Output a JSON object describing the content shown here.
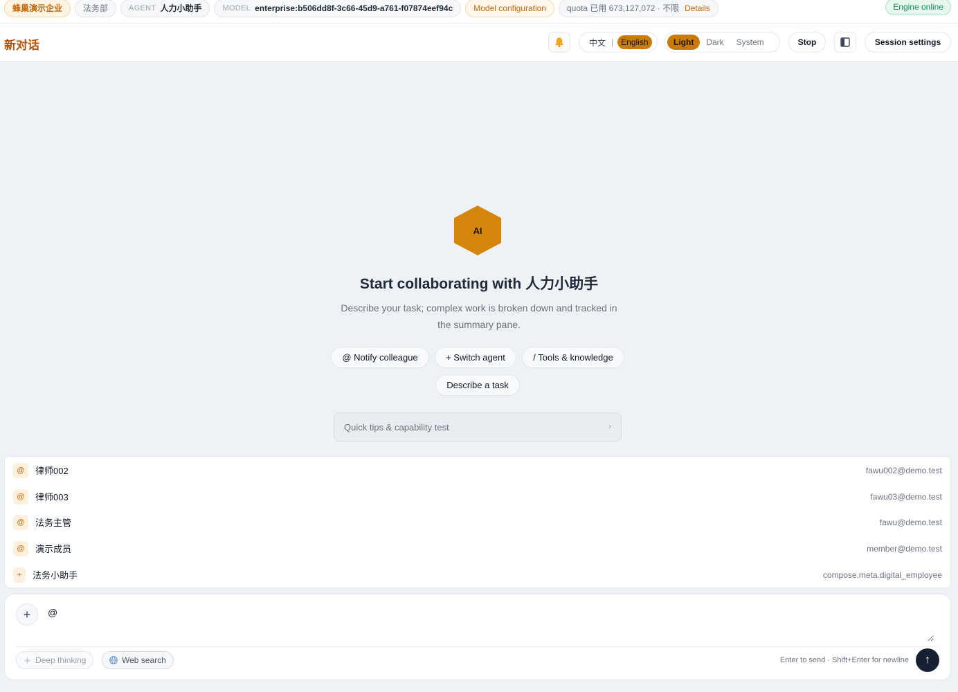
{
  "topbar": {
    "org": "蜂巢演示企业",
    "dept": "法务部",
    "agent_key": "AGENT",
    "agent_value": "人力小助手",
    "model_key": "MODEL",
    "model_value": "enterprise:b506dd8f-3c66-45d9-a761-f07874eef94c",
    "model_config": "Model configuration",
    "quota_text": "quota 已用 673,127,072 · 不限",
    "quota_details": "Details",
    "engine_status": "Engine online"
  },
  "header": {
    "title": "新对话",
    "lang_zh": "中文",
    "lang_sep": "|",
    "lang_en": "English",
    "theme_light": "Light",
    "theme_dark": "Dark",
    "theme_system": "System",
    "stop_label": "Stop",
    "session_settings": "Session settings",
    "icons": {
      "bell": "bell-icon",
      "panel": "panel-toggle-icon"
    },
    "accent_color": "#c97a08"
  },
  "hero": {
    "logo_text": "AI",
    "title": "Start collaborating with 人力小助手",
    "subtitle": "Describe your task; complex work is broken down and tracked in the summary pane.",
    "chips": {
      "notify": "@ Notify colleague",
      "switch": "+ Switch agent",
      "tools": "/ Tools & knowledge",
      "describe": "Describe a task"
    },
    "tips": "Quick tips & capability test",
    "tips_chevron": "›"
  },
  "mentions": [
    {
      "badge": "@",
      "name": "律师002",
      "email": "fawu002@demo.test"
    },
    {
      "badge": "@",
      "name": "律师003",
      "email": "fawu03@demo.test"
    },
    {
      "badge": "@",
      "name": "法务主管",
      "email": "fawu@demo.test"
    },
    {
      "badge": "@",
      "name": "演示成员",
      "email": "member@demo.test"
    },
    {
      "badge": "+",
      "name": "法务小助手",
      "email": "compose.meta.digital_employee"
    }
  ],
  "composer": {
    "plus": "+",
    "value": "@",
    "deep_thinking": "Deep thinking",
    "web_search": "Web search",
    "hint": "Enter to send · Shift+Enter for newline",
    "send": "↑"
  }
}
